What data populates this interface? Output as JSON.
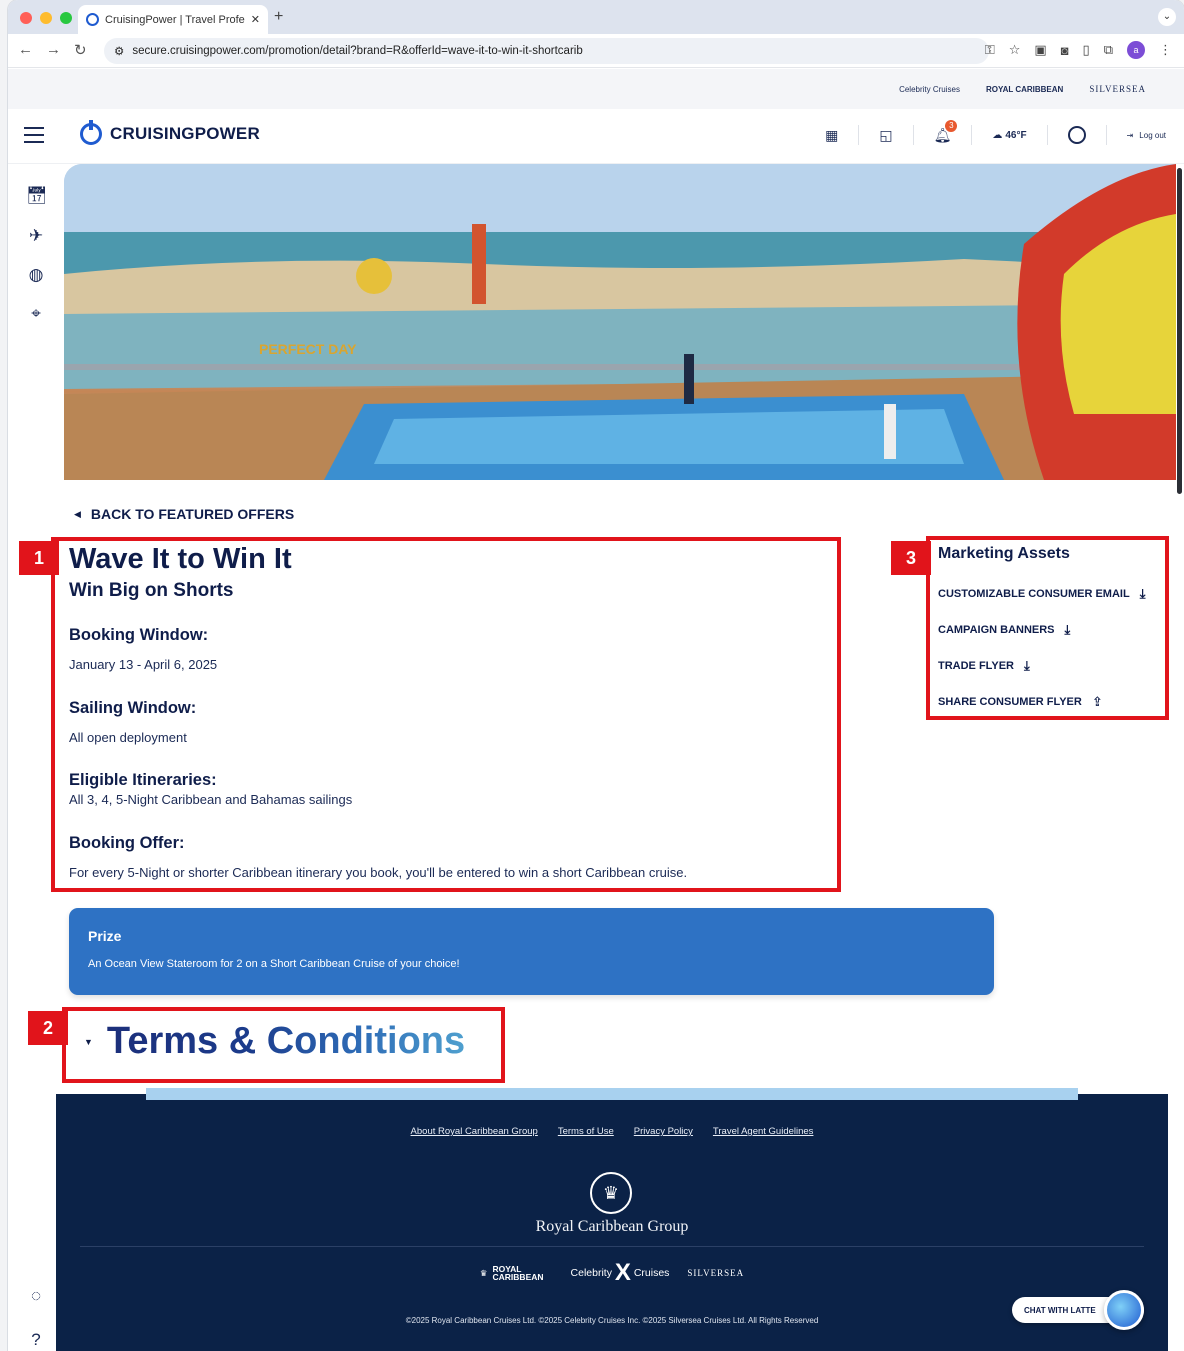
{
  "browser": {
    "tab_title": "CruisingPower | Travel Profes",
    "new_tab": "+",
    "url": "secure.cruisingpower.com/promotion/detail?brand=R&offerId=wave-it-to-win-it-shortcarib",
    "profile_initial": "a"
  },
  "brand_strip": {
    "celebrity": "Celebrity Cruises",
    "royal": "ROYAL CARIBBEAN",
    "silversea": "SILVERSEA"
  },
  "header": {
    "logo_text": "CRUISINGPOWER",
    "notifications_count": "3",
    "weather": "46°F",
    "logout": "Log out"
  },
  "main": {
    "back_link": "BACK TO FEATURED OFFERS",
    "title": "Wave It to Win It",
    "subtitle": "Win Big on Shorts",
    "booking_window_label": "Booking Window:",
    "booking_window_value": "January 13 - April 6, 2025",
    "sailing_window_label": "Sailing Window:",
    "sailing_window_value": "All open deployment",
    "itineraries_label": "Eligible Itineraries:",
    "itineraries_value": "All 3, 4, 5-Night Caribbean and Bahamas sailings",
    "offer_label": "Booking Offer:",
    "offer_value": "For every 5-Night or shorter Caribbean itinerary you book, you'll be entered to win a short Caribbean cruise.",
    "prize_title": "Prize",
    "prize_text": "An Ocean View Stateroom for 2 on a Short Caribbean Cruise of your choice!",
    "terms_title": "Terms & Conditions"
  },
  "marketing_assets": {
    "title": "Marketing Assets",
    "items": [
      {
        "label": "CUSTOMIZABLE CONSUMER EMAIL",
        "icon": "download-icon"
      },
      {
        "label": "CAMPAIGN BANNERS",
        "icon": "download-icon"
      },
      {
        "label": "TRADE FLYER",
        "icon": "download-icon"
      },
      {
        "label": "SHARE CONSUMER FLYER",
        "icon": "share-icon"
      }
    ]
  },
  "annotations": {
    "tag1": "1",
    "tag2": "2",
    "tag3": "3"
  },
  "hero": {
    "sign_text": "PERFECT DAY"
  },
  "footer": {
    "links": [
      "About Royal Caribbean Group",
      "Terms of Use",
      "Privacy Policy",
      "Travel Agent Guidelines"
    ],
    "group_name": "Royal Caribbean Group",
    "brand_royal": "ROYAL CARIBBEAN",
    "brand_celebrity_left": "Celebrity",
    "brand_celebrity_right": "Cruises",
    "brand_silversea": "SILVERSEA",
    "copyright": "©2025 Royal Caribbean Cruises Ltd. ©2025 Celebrity Cruises Inc. ©2025 Silversea Cruises Ltd. All Rights Reserved",
    "chat_label": "CHAT WITH LATTE"
  },
  "colors": {
    "accent_blue": "#2e72c4",
    "annotation_red": "#e1141b",
    "navy": "#0f1d4a",
    "footer_bg": "#0b2247"
  }
}
